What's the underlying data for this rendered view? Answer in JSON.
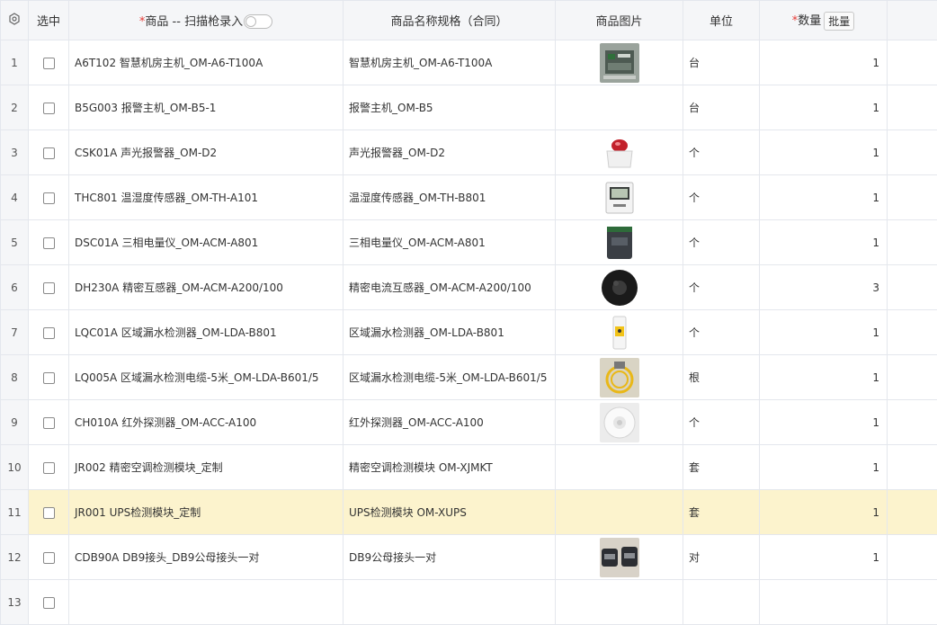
{
  "header": {
    "select_col": "选中",
    "product_required_mark": "*",
    "product_col": "商品 -- 扫描枪录入",
    "spec_col": "商品名称规格（合同）",
    "image_col": "商品图片",
    "unit_col": "单位",
    "qty_required_mark": "*",
    "qty_col": "数量",
    "batch_button": "批量",
    "scan_toggle_on": false
  },
  "rows": [
    {
      "idx": "1",
      "name": "A6T102 智慧机房主机_OM-A6-T100A",
      "spec": "智慧机房主机_OM-A6-T100A",
      "unit": "台",
      "qty": "1",
      "image": "device-board"
    },
    {
      "idx": "2",
      "name": "B5G003 报警主机_OM-B5-1",
      "spec": "报警主机_OM-B5",
      "unit": "台",
      "qty": "1",
      "image": ""
    },
    {
      "idx": "3",
      "name": "CSK01A 声光报警器_OM-D2",
      "spec": "声光报警器_OM-D2",
      "unit": "个",
      "qty": "1",
      "image": "alarm-light"
    },
    {
      "idx": "4",
      "name": "THC801 温湿度传感器_OM-TH-A101",
      "spec": "温湿度传感器_OM-TH-B801",
      "unit": "个",
      "qty": "1",
      "image": "lcd-sensor"
    },
    {
      "idx": "5",
      "name": "DSC01A 三相电量仪_OM-ACM-A801",
      "spec": "三相电量仪_OM-ACM-A801",
      "unit": "个",
      "qty": "1",
      "image": "meter-box"
    },
    {
      "idx": "6",
      "name": "DH230A 精密互感器_OM-ACM-A200/100",
      "spec": "精密电流互感器_OM-ACM-A200/100",
      "unit": "个",
      "qty": "3",
      "image": "black-ring"
    },
    {
      "idx": "7",
      "name": "LQC01A 区域漏水检测器_OM-LDA-B801",
      "spec": "区域漏水检测器_OM-LDA-B801",
      "unit": "个",
      "qty": "1",
      "image": "leak-detector"
    },
    {
      "idx": "8",
      "name": "LQ005A 区域漏水检测电缆-5米_OM-LDA-B601/5",
      "spec": "区域漏水检测电缆-5米_OM-LDA-B601/5",
      "unit": "根",
      "qty": "1",
      "image": "cable-coil"
    },
    {
      "idx": "9",
      "name": "CH010A 红外探测器_OM-ACC-A100",
      "spec": "红外探测器_OM-ACC-A100",
      "unit": "个",
      "qty": "1",
      "image": "ir-dome"
    },
    {
      "idx": "10",
      "name": "JR002 精密空调检测模块_定制",
      "spec": "精密空调检测模块 OM-XJMKT",
      "unit": "套",
      "qty": "1",
      "image": ""
    },
    {
      "idx": "11",
      "name": "JR001 UPS检测模块_定制",
      "spec": "UPS检测模块 OM-XUPS",
      "unit": "套",
      "qty": "1",
      "image": "",
      "selected": true
    },
    {
      "idx": "12",
      "name": "CDB90A DB9接头_DB9公母接头一对",
      "spec": "DB9公母接头一对",
      "unit": "对",
      "qty": "1",
      "image": "db9-connectors"
    },
    {
      "idx": "13",
      "name": "",
      "spec": "",
      "unit": "",
      "qty": "",
      "image": ""
    }
  ]
}
